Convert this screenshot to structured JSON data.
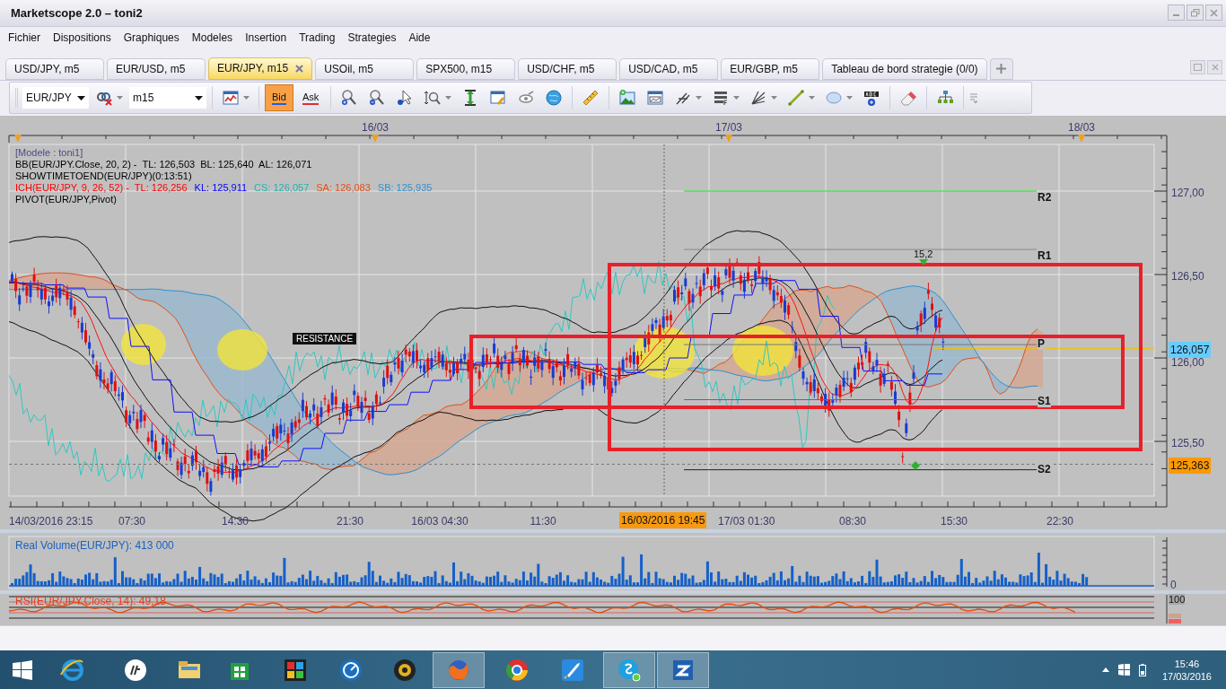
{
  "window": {
    "title": "Marketscope 2.0 – toni2"
  },
  "menu": [
    "Fichier",
    "Dispositions",
    "Graphiques",
    "Modeles",
    "Insertion",
    "Trading",
    "Strategies",
    "Aide"
  ],
  "tabs": [
    {
      "label": "USD/JPY, m5",
      "selected": false
    },
    {
      "label": "EUR/USD, m5",
      "selected": false
    },
    {
      "label": "EUR/JPY, m15",
      "selected": true
    },
    {
      "label": "USOil, m5",
      "selected": false
    },
    {
      "label": "SPX500, m15",
      "selected": false
    },
    {
      "label": "USD/CHF, m5",
      "selected": false
    },
    {
      "label": "USD/CAD, m5",
      "selected": false
    },
    {
      "label": "EUR/GBP, m5",
      "selected": false
    },
    {
      "label": "Tableau de bord strategie (0/0)",
      "selected": false
    }
  ],
  "toolbar": {
    "symbol": "EUR/JPY",
    "timeframe": "m15",
    "price_buttons": [
      {
        "label": "Bid",
        "selected": true
      },
      {
        "label": "Ask",
        "selected": false
      }
    ]
  },
  "chart": {
    "top_dates": [
      "16/03",
      "17/03",
      "18/03"
    ],
    "legend": [
      [
        {
          "text": "[Modele : toni1]",
          "color": "#4a4a8a"
        }
      ],
      [
        {
          "text": "BB(EUR/JPY.Close, 20, 2) -  TL: 126,503  BL: 125,640  AL: 126,071",
          "color": "#000000"
        }
      ],
      [
        {
          "text": "SHOWTIMETOEND(EUR/JPY)(0:13:51)",
          "color": "#000000"
        }
      ],
      [
        {
          "text": "ICH(EUR/JPY, 9, 26, 52) -  TL: 126,256",
          "color": "#ff0000"
        },
        {
          "text": "KL: 125,911",
          "color": "#0000ff"
        },
        {
          "text": "CS: 126,057",
          "color": "#20b2aa"
        },
        {
          "text": "SA: 126,083",
          "color": "#e0501a"
        },
        {
          "text": "SB: 125,935",
          "color": "#2f8fd0"
        }
      ],
      [
        {
          "text": "PIVOT(EUR/JPY,Pivot)",
          "color": "#000000"
        }
      ]
    ],
    "price_ticks": [
      "127,00",
      "126,50",
      "126,00",
      "125,50"
    ],
    "price_markers": [
      {
        "text": "126,057",
        "color": "#66ccff"
      },
      {
        "text": "125,363",
        "color": "#ff9900"
      }
    ],
    "pivot_labels": [
      "R2",
      "R1",
      "P",
      "S1",
      "S2"
    ],
    "annotation": "RESISTANCE",
    "marker_value": "15,2",
    "time_labels": [
      "14/03/2016 23:15",
      "07:30",
      "14:30",
      "21:30",
      "16/03 04:30",
      "11:30",
      "17/03 01:30",
      "08:30",
      "15:30",
      "22:30"
    ],
    "cursor_time": "16/03/2016 19:45"
  },
  "volume": {
    "title": "Real Volume(EUR/JPY): 413 000",
    "axis": "0"
  },
  "rsi": {
    "title": "RSI(EUR/JPY.Close, 14): 49,18",
    "axis": "100"
  },
  "taskbar": {
    "apps": [
      {
        "active": false
      },
      {
        "active": false
      },
      {
        "active": false
      },
      {
        "active": false
      },
      {
        "active": false
      },
      {
        "active": false
      },
      {
        "active": false
      },
      {
        "active": true
      },
      {
        "active": false
      },
      {
        "active": false
      },
      {
        "active": true
      },
      {
        "active": true
      }
    ],
    "time": "15:46",
    "date": "17/03/2016"
  }
}
